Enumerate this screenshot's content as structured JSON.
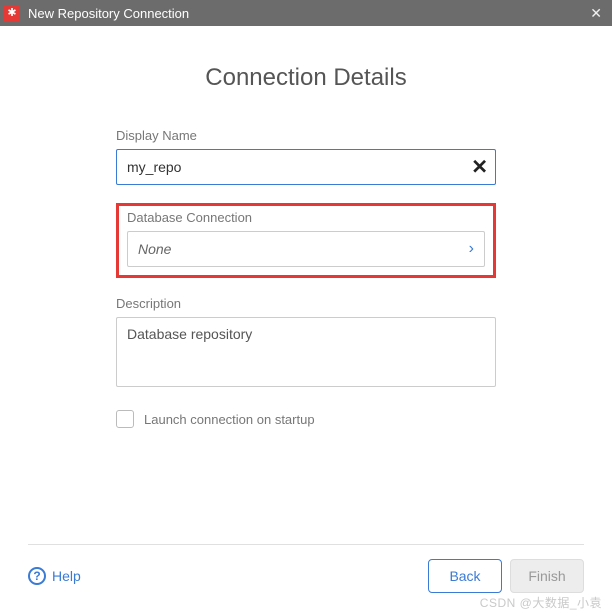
{
  "window": {
    "title": "New Repository Connection"
  },
  "page": {
    "heading": "Connection Details"
  },
  "form": {
    "display_name": {
      "label": "Display Name",
      "value": "my_repo"
    },
    "db_connection": {
      "label": "Database Connection",
      "value": "None"
    },
    "description": {
      "label": "Description",
      "value": "Database repository"
    },
    "launch_on_startup": {
      "label": "Launch connection on startup",
      "checked": false
    }
  },
  "footer": {
    "help": "Help",
    "back": "Back",
    "finish": "Finish"
  },
  "watermark": "CSDN @大数据_小袁"
}
